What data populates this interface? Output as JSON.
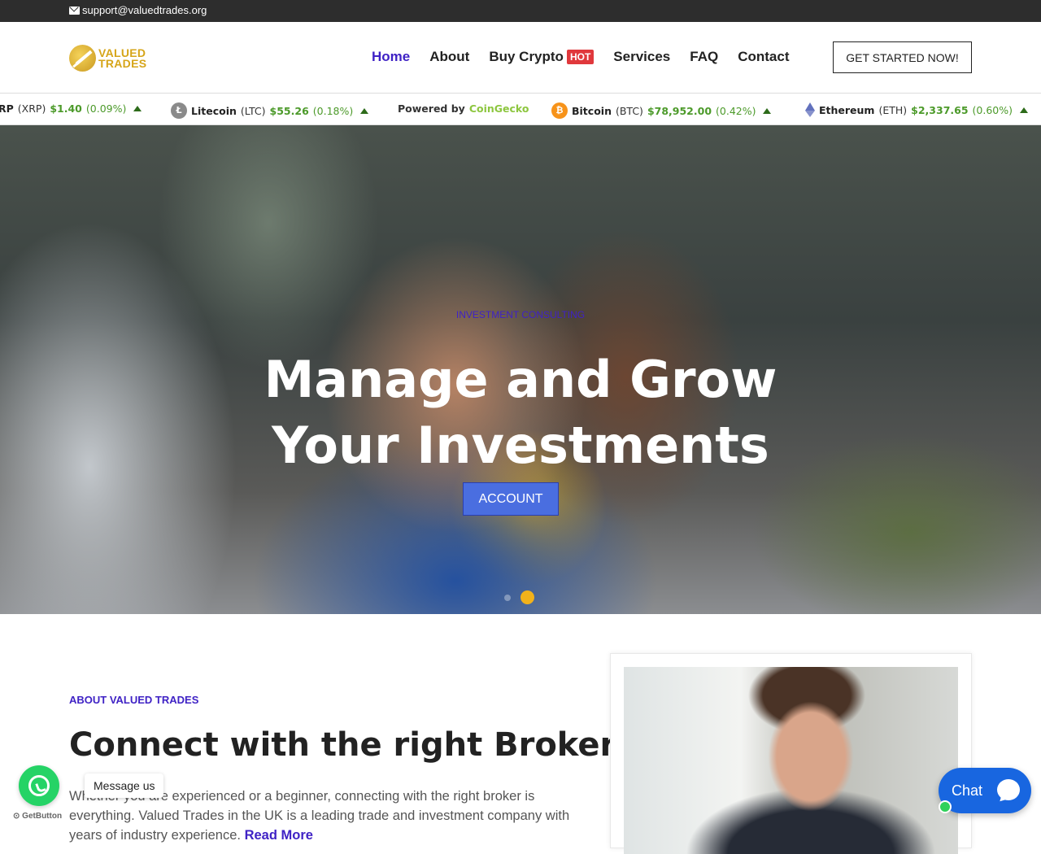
{
  "topbar": {
    "email": "support@valuedtrades.org",
    "email_icon": "envelope-icon"
  },
  "header": {
    "logo": {
      "line1": "VALUED",
      "line2": "TRADES"
    },
    "nav": [
      {
        "label": "Home",
        "active": true
      },
      {
        "label": "About"
      },
      {
        "label": "Buy Crypto",
        "badge": "HOT"
      },
      {
        "label": "Services"
      },
      {
        "label": "FAQ"
      },
      {
        "label": "Contact"
      }
    ],
    "cta_label": "GET STARTED NOW!"
  },
  "ticker": {
    "items": [
      {
        "name": "RP",
        "symbol": "(XRP)",
        "price": "$1.40",
        "change": "(0.09%)"
      },
      {
        "name": "Litecoin",
        "symbol": "(LTC)",
        "price": "$55.26",
        "change": "(0.18%)"
      },
      {
        "name": "Bitcoin",
        "symbol": "(BTC)",
        "price": "$78,952.00",
        "change": "(0.42%)"
      },
      {
        "name": "Ethereum",
        "symbol": "(ETH)",
        "price": "$2,337.65",
        "change": "(0.60%)"
      }
    ],
    "powered_prefix": "Powered by",
    "powered_brand": "CoinGecko",
    "up_color": "#4c9a2a"
  },
  "hero": {
    "eyebrow": "INVESTMENT CONSULTING",
    "title_line1": "Manage and Grow",
    "title_line2": "Your Investments",
    "button_label": "ACCOUNT",
    "slides": 2,
    "active_slide": 2
  },
  "about": {
    "eyebrow": "ABOUT VALUED TRADES",
    "title": "Connect with the right Broker.",
    "text_line1": "Whether you are experienced or a beginner, connecting with the right broker is everything.",
    "text_line2": "Valued Trades in the UK is a leading trade and investment company with years of industry",
    "text_line3": "experience.",
    "read_more": "Read More"
  },
  "widgets": {
    "whatsapp_label": "Message us",
    "getbutton": "GetButton",
    "chat_label": "Chat"
  },
  "colors": {
    "accent": "#3f22c5",
    "hot": "#e0383c",
    "gold": "#d6a519",
    "chat": "#1866e0",
    "whatsapp": "#25d366"
  }
}
